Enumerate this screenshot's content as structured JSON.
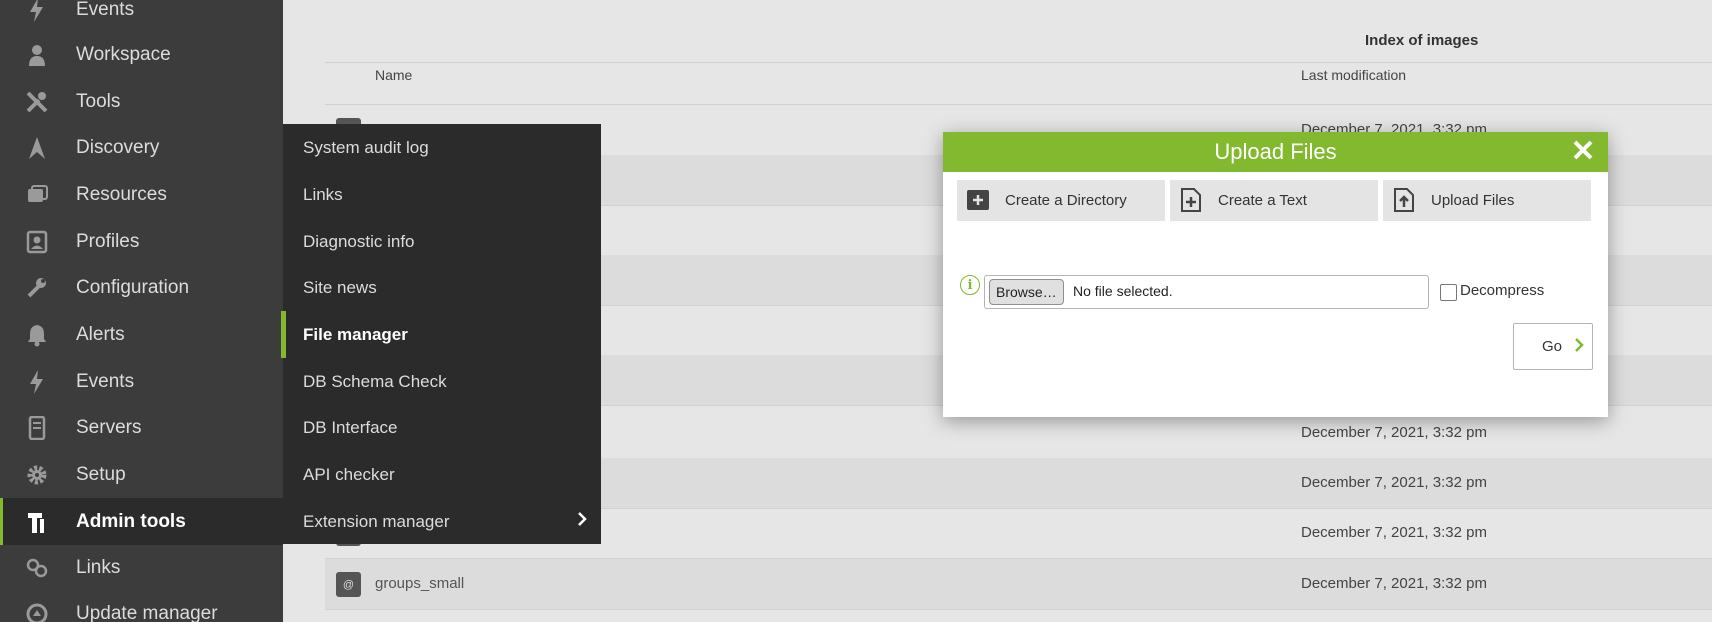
{
  "sidebar": {
    "items": [
      {
        "label": "Events",
        "icon": "lightning-icon"
      },
      {
        "label": "Workspace",
        "icon": "user-icon"
      },
      {
        "label": "Tools",
        "icon": "tools-icon"
      },
      {
        "label": "Discovery",
        "icon": "discovery-icon"
      },
      {
        "label": "Resources",
        "icon": "resources-icon"
      },
      {
        "label": "Profiles",
        "icon": "profile-icon"
      },
      {
        "label": "Configuration",
        "icon": "wrench-icon"
      },
      {
        "label": "Alerts",
        "icon": "bell-icon"
      },
      {
        "label": "Events",
        "icon": "lightning-icon"
      },
      {
        "label": "Servers",
        "icon": "server-icon"
      },
      {
        "label": "Setup",
        "icon": "gear-icon"
      },
      {
        "label": "Admin tools",
        "icon": "admin-tools-icon",
        "active": true
      },
      {
        "label": "Links",
        "icon": "link-icon"
      },
      {
        "label": "Update manager",
        "icon": "update-icon"
      }
    ]
  },
  "submenu": {
    "items": [
      {
        "label": "System audit log"
      },
      {
        "label": "Links"
      },
      {
        "label": "Diagnostic info"
      },
      {
        "label": "Site news"
      },
      {
        "label": "File manager",
        "active": true
      },
      {
        "label": "DB Schema Check"
      },
      {
        "label": "DB Interface"
      },
      {
        "label": "API checker"
      },
      {
        "label": "Extension manager",
        "has_submenu": true
      }
    ]
  },
  "main": {
    "index_title": "Index of images",
    "columns": {
      "name": "Name",
      "last_modification": "Last modification"
    },
    "rows": [
      {
        "name": "",
        "date": "December 7, 2021, 3:32 pm"
      },
      {
        "name": "",
        "date": ""
      },
      {
        "name": "",
        "date": ""
      },
      {
        "name": "",
        "date": ""
      },
      {
        "name": "",
        "date": ""
      },
      {
        "name": "",
        "date": ""
      },
      {
        "name": "",
        "date": "December 7, 2021, 3:32 pm"
      },
      {
        "name": "",
        "date": "December 7, 2021, 3:32 pm"
      },
      {
        "name": "",
        "date": "December 7, 2021, 3:32 pm"
      },
      {
        "name": "groups_small",
        "date": "December 7, 2021, 3:32 pm"
      }
    ]
  },
  "dialog": {
    "title": "Upload Files",
    "close_icon": "close-icon",
    "tabs": [
      {
        "label": "Create a Directory",
        "icon": "add-directory-icon"
      },
      {
        "label": "Create a Text",
        "icon": "add-text-icon"
      },
      {
        "label": "Upload Files",
        "icon": "upload-icon"
      }
    ],
    "info_icon_glyph": "i",
    "browse_label": "Browse…",
    "file_status": "No file selected.",
    "decompress_label": "Decompress",
    "decompress_checked": false,
    "go_label": "Go"
  },
  "colors": {
    "accent": "#82b92e",
    "sidebar_bg": "#3c3c3c",
    "submenu_bg": "#2b2b2b",
    "page_bg": "#e6e6e6"
  }
}
